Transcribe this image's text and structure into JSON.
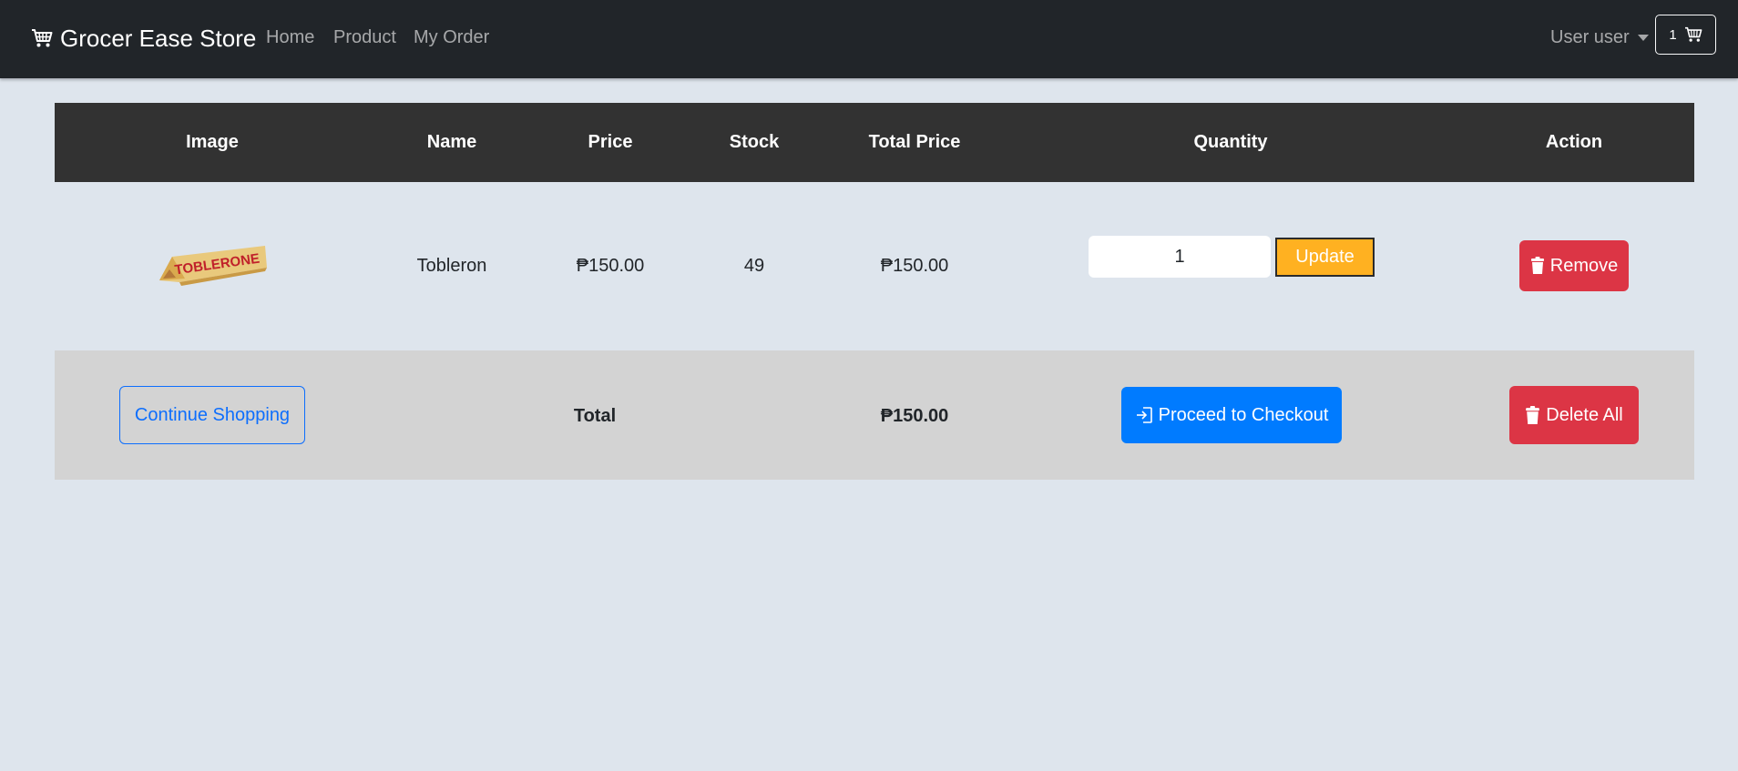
{
  "nav": {
    "brand": "Grocer Ease Store",
    "links": [
      "Home",
      "Product",
      "My Order"
    ],
    "user": "User user",
    "cart_count": "1"
  },
  "table": {
    "headers": [
      "Image",
      "Name",
      "Price",
      "Stock",
      "Total Price",
      "Quantity",
      "Action"
    ],
    "rows": [
      {
        "image_alt": "TOBLERONE",
        "name": "Tobleron",
        "price": "₱150.00",
        "stock": "49",
        "total_price": "₱150.00",
        "quantity": "1",
        "update_label": "Update",
        "remove_label": "Remove"
      }
    ]
  },
  "footer": {
    "continue_label": "Continue Shopping",
    "total_label": "Total",
    "total_value": "₱150.00",
    "checkout_label": "Proceed to Checkout",
    "delete_all_label": "Delete All"
  },
  "colors": {
    "navbar": "#212529",
    "background": "#dee5ed",
    "header": "#323232",
    "footer_row": "#d3d3d3",
    "update": "#ffb121",
    "danger": "#dc3545",
    "primary": "#007bff"
  }
}
